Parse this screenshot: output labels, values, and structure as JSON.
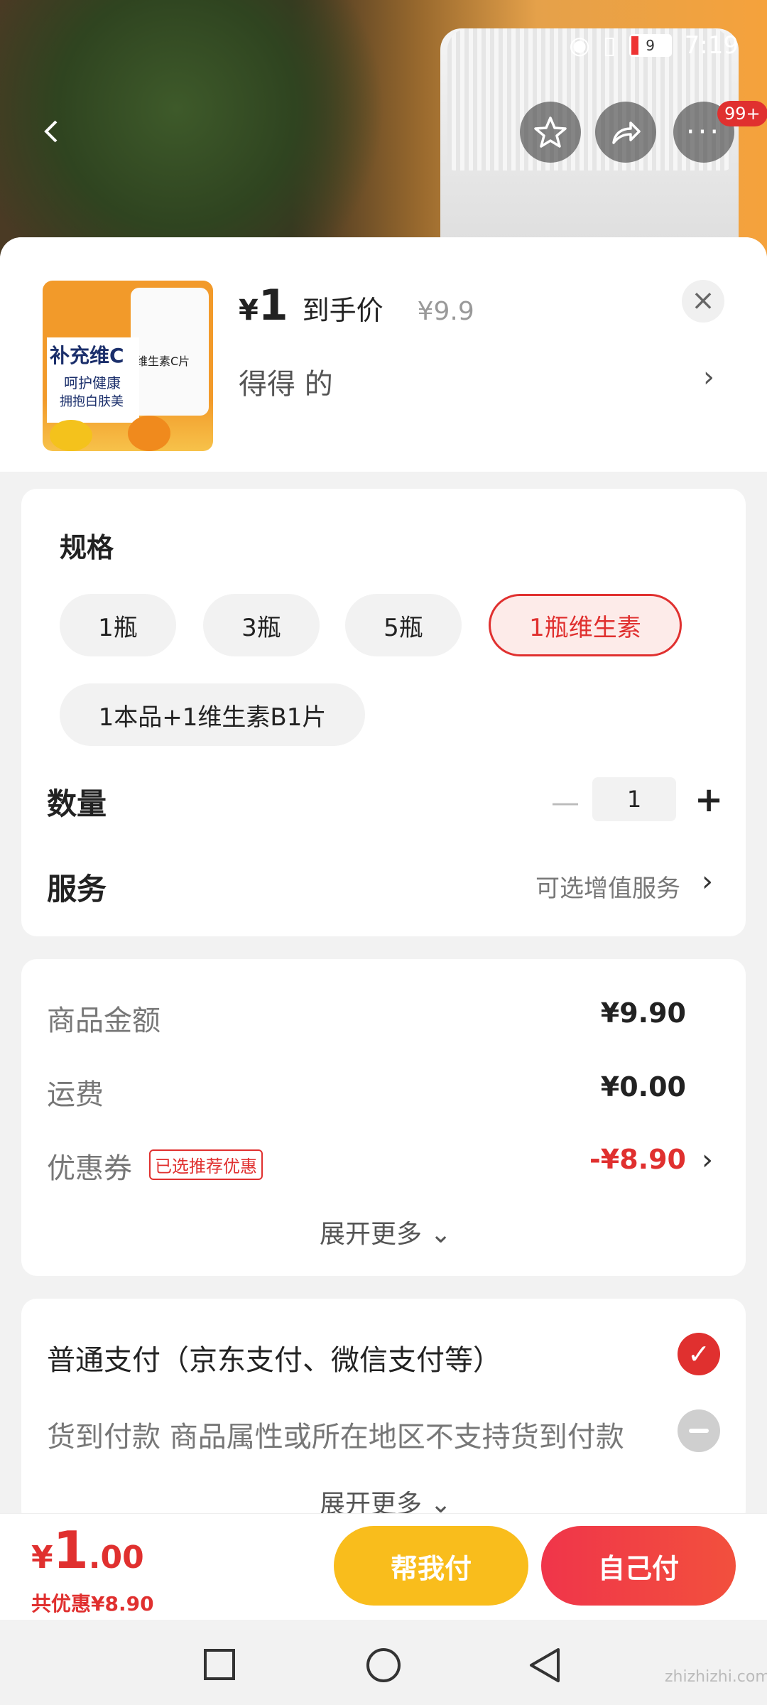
{
  "status_bar": {
    "battery": "9",
    "time": "7:19"
  },
  "header": {
    "badge": "99+"
  },
  "product": {
    "thumb_title": "补充维C",
    "thumb_line1": "呵护健康",
    "thumb_line2": "拥抱白肤美",
    "thumb_bottle_label": "维生素C片",
    "currency": "¥",
    "price": "1",
    "price_label": "到手价",
    "original_price": "¥9.9",
    "seller": "得得  的"
  },
  "spec": {
    "title": "规格",
    "options": [
      "1瓶",
      "3瓶",
      "5瓶",
      "1瓶维生素",
      "1本品+1维生素B1片"
    ],
    "selected": "1瓶维生素"
  },
  "quantity": {
    "label": "数量",
    "value": "1"
  },
  "service": {
    "label": "服务",
    "value": "可选增值服务"
  },
  "summary": {
    "goods_label": "商品金额",
    "goods_value": "¥9.90",
    "shipping_label": "运费",
    "shipping_value": "¥0.00",
    "coupon_label": "优惠券",
    "coupon_tag": "已选推荐优惠",
    "coupon_value": "-¥8.90",
    "expand": "展开更多"
  },
  "payment": {
    "normal": "普通支付（京东支付、微信支付等）",
    "cod": "货到付款   商品属性或所在地区不支持货到付款",
    "expand": "展开更多"
  },
  "footer": {
    "currency": "¥",
    "total_int": "1",
    "total_dec": ".00",
    "saved": "共优惠¥8.90",
    "help_pay": "帮我付",
    "self_pay": "自己付"
  },
  "watermark": "zhizhizhi.com",
  "colors": {
    "accent": "#e0302f",
    "help_btn": "#f9bd1c"
  }
}
